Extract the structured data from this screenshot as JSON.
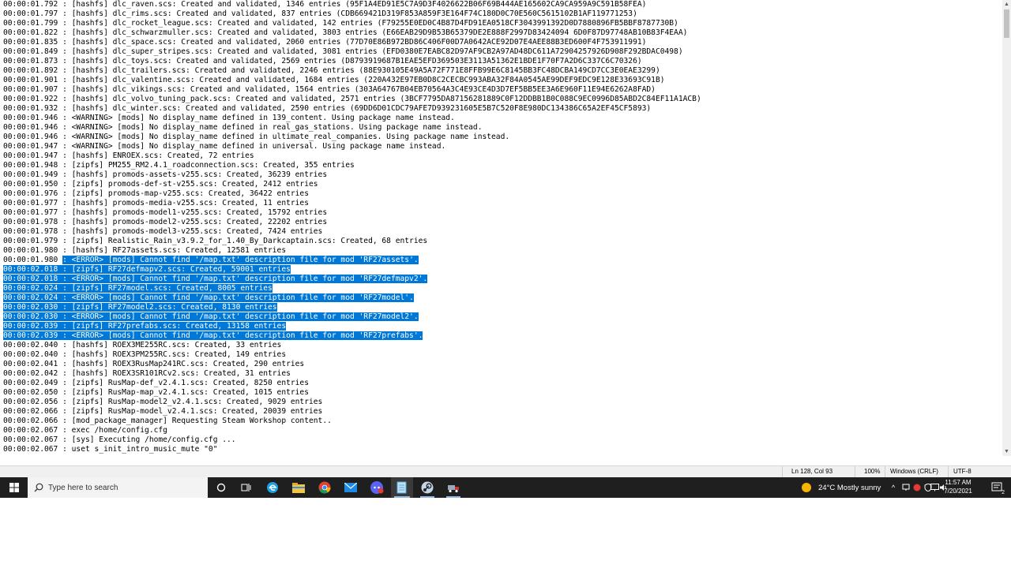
{
  "log": {
    "lines": [
      "00:00:01.792 : [hashfs] dlc_raven.scs: Created and validated, 1346 entries (95F1A4ED91E5C7A9D3F4026622B06F69B444AE165602CA9CA959A9C591B58FEA)",
      "00:00:01.797 : [hashfs] dlc_rims.scs: Created and validated, 837 entries (CDB669421D319F853A859F3E164F74C180D0C70E560C5615102B1AF119771253)",
      "00:00:01.799 : [hashfs] dlc_rocket_league.scs: Created and validated, 142 entries (F79255E0ED0C4B87D4FD91EA0518CF3043991392D0D7880896FB5BBF8787730B)",
      "00:00:01.822 : [hashfs] dlc_schwarzmuller.scs: Created and validated, 3803 entries (E66EAB29D9B53B65379DE2E888F2997D83424094 6D0F87D97748AB10B83F4EAA)",
      "00:00:01.835 : [hashfs] dlc_space.scs: Created and validated, 2060 entries (77D70E86B972BD86C406F00D7A0642ACE92D07E4AEE88B3ED600F4F753911991)",
      "00:00:01.849 : [hashfs] dlc_super_stripes.scs: Created and validated, 3081 entries (EFD0380E7EABC82D97AF9CB2A97AD48DC611A72904257926D908F292BDAC0498)",
      "00:00:01.873 : [hashfs] dlc_toys.scs: Created and validated, 2569 entries (D8793919687B1EAE5EFD369503E3113A51362E1BDE1F70F7A2D6C337C6C70326)",
      "00:00:01.892 : [hashfs] dlc_trailers.scs: Created and validated, 2246 entries (88E930105E49A5A72F771E8FFB99E6C8145BB3FC48DCBA149CD7CC3E0EAE3299)",
      "00:00:01.901 : [hashfs] dlc_valentine.scs: Created and validated, 1684 entries (220A432E97EB0D8C2CECBC993ABA32F84A0545AE99DEF9EDC9E128E33693C91B)",
      "00:00:01.907 : [hashfs] dlc_vikings.scs: Created and validated, 1564 entries (303A64767B04EB70564A3C4E93CE4D3D7EF5BB5EE3A6E960F11E94E6262A8FAD)",
      "00:00:01.922 : [hashfs] dlc_volvo_tuning_pack.scs: Created and validated, 2571 entries (3BCF7795DA87156281889C0F12DDBB1B0C088C9EC0996D85ABD2C84EF11A1ACB)",
      "00:00:01.932 : [hashfs] dlc_winter.scs: Created and validated, 2590 entries (69DD6D01CDC79AFE7D939231605E5B7C520F8E980DC134386C65A2EF45CF5893)",
      "00:00:01.946 : <WARNING> [mods] No display_name defined in 139_content. Using package name instead.",
      "00:00:01.946 : <WARNING> [mods] No display_name defined in real_gas_stations. Using package name instead.",
      "00:00:01.946 : <WARNING> [mods] No display_name defined in ultimate_real_companies. Using package name instead.",
      "00:00:01.947 : <WARNING> [mods] No display_name defined in universal. Using package name instead.",
      "00:00:01.947 : [hashfs] ENROEX.scs: Created, 72 entries",
      "00:00:01.948 : [zipfs] PM255_RM2.4.1_roadconnection.scs: Created, 355 entries",
      "00:00:01.949 : [hashfs] promods-assets-v255.scs: Created, 36239 entries",
      "00:00:01.950 : [zipfs] promods-def-st-v255.scs: Created, 2412 entries",
      "00:00:01.976 : [zipfs] promods-map-v255.scs: Created, 36422 entries",
      "00:00:01.977 : [hashfs] promods-media-v255.scs: Created, 11 entries",
      "00:00:01.977 : [hashfs] promods-model1-v255.scs: Created, 15792 entries",
      "00:00:01.978 : [hashfs] promods-model2-v255.scs: Created, 22202 entries",
      "00:00:01.978 : [hashfs] promods-model3-v255.scs: Created, 7424 entries",
      "00:00:01.979 : [zipfs] Realistic_Rain_v3.9.2_for_1.40_By_Darkcaptain.scs: Created, 68 entries",
      "00:00:01.980 : [hashfs] RF27assets.scs: Created, 12581 entries",
      "00:00:01.980 : <ERROR> [mods] Cannot find '/map.txt' description file for mod 'RF27assets'.",
      "00:00:02.018 : [zipfs] RF27defmapv2.scs: Created, 59001 entries",
      "00:00:02.018 : <ERROR> [mods] Cannot find '/map.txt' description file for mod 'RF27defmapv2'.",
      "00:00:02.024 : [zipfs] RF27model.scs: Created, 8005 entries",
      "00:00:02.024 : <ERROR> [mods] Cannot find '/map.txt' description file for mod 'RF27model'.",
      "00:00:02.030 : [zipfs] RF27model2.scs: Created, 8130 entries",
      "00:00:02.030 : <ERROR> [mods] Cannot find '/map.txt' description file for mod 'RF27model2'.",
      "00:00:02.039 : [zipfs] RF27prefabs.scs: Created, 13158 entries",
      "00:00:02.039 : <ERROR> [mods] Cannot find '/map.txt' description file for mod 'RF27prefabs'.",
      "00:00:02.040 : [hashfs] ROEX3ME255RC.scs: Created, 33 entries",
      "00:00:02.040 : [hashfs] ROEX3PM255RC.scs: Created, 149 entries",
      "00:00:02.041 : [hashfs] ROEX3RusMap241RC.scs: Created, 290 entries",
      "00:00:02.042 : [hashfs] ROEX3SR101RCv2.scs: Created, 31 entries",
      "00:00:02.049 : [zipfs] RusMap-def_v2.4.1.scs: Created, 8250 entries",
      "00:00:02.050 : [zipfs] RusMap-map_v2.4.1.scs: Created, 1015 entries",
      "00:00:02.056 : [zipfs] RusMap-model2_v2.4.1.scs: Created, 9029 entries",
      "00:00:02.066 : [zipfs] RusMap-model_v2.4.1.scs: Created, 20039 entries",
      "00:00:02.066 : [mod_package_manager] Requesting Steam Workshop content..",
      "00:00:02.067 : exec /home/config.cfg",
      "00:00:02.067 : [sys] Executing /home/config.cfg ...",
      "00:00:02.067 : uset s_init_intro_music_mute \"0\""
    ]
  },
  "status": {
    "position": "Ln 128, Col 93",
    "zoom": "100%",
    "line_ending": "Windows (CRLF)",
    "encoding": "UTF-8"
  },
  "taskbar": {
    "search_placeholder": "Type here to search",
    "weather": "24°C  Mostly sunny",
    "time": "11:57 AM",
    "date": "7/20/2021",
    "notification_count": "2"
  }
}
